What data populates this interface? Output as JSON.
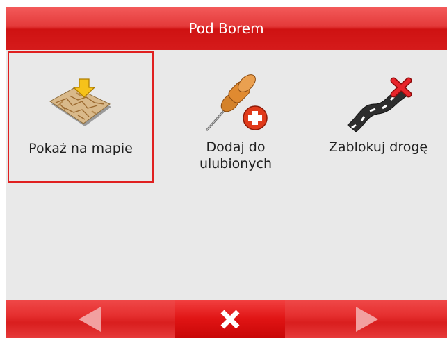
{
  "header": {
    "title": "Pod Borem"
  },
  "tiles": [
    {
      "label": "Pokaż na mapie",
      "icon": "map-icon",
      "selected": true
    },
    {
      "label": "Dodaj do ulubionych",
      "icon": "pushpin-add-icon",
      "selected": false
    },
    {
      "label": "Zablokuj drogę",
      "icon": "road-block-icon",
      "selected": false
    }
  ],
  "footer": {
    "prev_icon": "left-arrow-icon",
    "close_icon": "close-icon",
    "next_icon": "right-arrow-icon"
  },
  "colors": {
    "accent": "#e02020",
    "background": "#e9e9e9"
  }
}
